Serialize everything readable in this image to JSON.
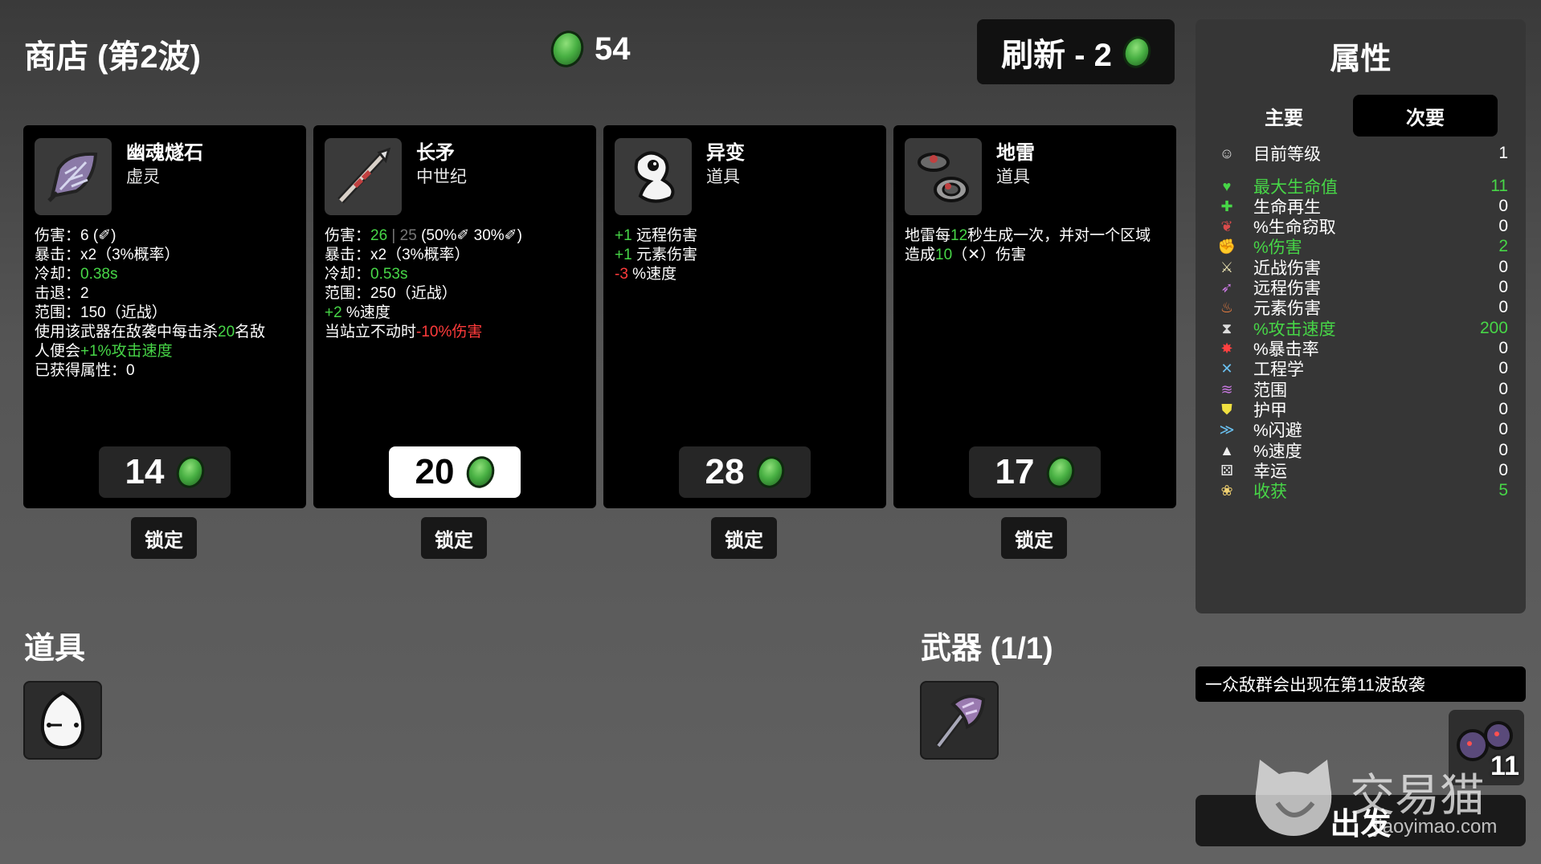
{
  "header": {
    "title": "商店 (第2波)",
    "gold": "54",
    "refresh_label": "刷新 - 2"
  },
  "shop": {
    "cards": [
      {
        "name": "幽魂燧石",
        "subtitle": "虚灵",
        "price": "14",
        "lock_label": "锁定",
        "icon": "flint-leaf-icon",
        "lines": [
          [
            {
              "t": "伤害：6 (",
              "c": ""
            },
            {
              "t": "✐",
              "c": ""
            },
            {
              "t": ")",
              "c": ""
            }
          ],
          [
            {
              "t": "暴击：x2（3%概率）",
              "c": ""
            }
          ],
          [
            {
              "t": "冷却：",
              "c": ""
            },
            {
              "t": "0.38s",
              "c": "g"
            }
          ],
          [
            {
              "t": "击退：2",
              "c": ""
            }
          ],
          [
            {
              "t": "范围：150（近战）",
              "c": ""
            }
          ],
          [
            {
              "t": "使用该武器在敌袭中每击杀",
              "c": ""
            },
            {
              "t": "20",
              "c": "g"
            },
            {
              "t": "名敌",
              "c": ""
            }
          ],
          [
            {
              "t": "人便会",
              "c": ""
            },
            {
              "t": "+1%攻击速度",
              "c": "g"
            }
          ],
          [
            {
              "t": "已获得属性：0",
              "c": ""
            }
          ]
        ]
      },
      {
        "name": "长矛",
        "subtitle": "中世纪",
        "price": "20",
        "lock_label": "锁定",
        "icon": "spear-icon",
        "selected": true,
        "lines": [
          [
            {
              "t": "伤害：",
              "c": ""
            },
            {
              "t": "26",
              "c": "g"
            },
            {
              "t": " | 25",
              "c": "gr"
            },
            {
              "t": " (50%✐ 30%✐)",
              "c": ""
            }
          ],
          [
            {
              "t": "暴击：x2（3%概率）",
              "c": ""
            }
          ],
          [
            {
              "t": "冷却：",
              "c": ""
            },
            {
              "t": "0.53s",
              "c": "g"
            }
          ],
          [
            {
              "t": "范围：250（近战）",
              "c": ""
            }
          ],
          [
            {
              "t": "+2",
              "c": "g"
            },
            {
              "t": " %速度",
              "c": ""
            }
          ],
          [
            {
              "t": "当站立不动时",
              "c": ""
            },
            {
              "t": "-10%伤害",
              "c": "r"
            }
          ]
        ]
      },
      {
        "name": "异变",
        "subtitle": "道具",
        "price": "28",
        "lock_label": "锁定",
        "icon": "ghost-blob-icon",
        "lines": [
          [
            {
              "t": "+1",
              "c": "g"
            },
            {
              "t": " 远程伤害",
              "c": ""
            }
          ],
          [
            {
              "t": "+1",
              "c": "g"
            },
            {
              "t": " 元素伤害",
              "c": ""
            }
          ],
          [
            {
              "t": "-3",
              "c": "r"
            },
            {
              "t": " %速度",
              "c": ""
            }
          ]
        ]
      },
      {
        "name": "地雷",
        "subtitle": "道具",
        "price": "17",
        "lock_label": "锁定",
        "icon": "landmine-icon",
        "lines": [
          [
            {
              "t": "地雷每",
              "c": ""
            },
            {
              "t": "12",
              "c": "g"
            },
            {
              "t": "秒生成一次，并对一个区域",
              "c": ""
            }
          ],
          [
            {
              "t": "造成",
              "c": ""
            },
            {
              "t": "10",
              "c": "g"
            },
            {
              "t": "（✕）伤害",
              "c": ""
            }
          ]
        ]
      }
    ]
  },
  "items_section": {
    "title": "道具",
    "items": [
      "egg-icon"
    ]
  },
  "weapons_section": {
    "title": "武器 (1/1)",
    "items": [
      "axe-icon"
    ]
  },
  "stats_panel": {
    "title": "属性",
    "tabs": [
      {
        "label": "主要",
        "active": false
      },
      {
        "label": "次要",
        "active": true
      }
    ],
    "rows": [
      {
        "label": "目前等级",
        "value": "1",
        "icon": "level-icon",
        "ic": "#ddd",
        "glyph": "☺",
        "highlight": false
      },
      {
        "label": "最大生命值",
        "value": "11",
        "icon": "heart-icon",
        "ic": "#47d647",
        "glyph": "♥",
        "highlight": true
      },
      {
        "label": "生命再生",
        "value": "0",
        "icon": "regen-icon",
        "ic": "#47d647",
        "glyph": "✚",
        "highlight": false
      },
      {
        "label": "%生命窃取",
        "value": "0",
        "icon": "lifesteal-icon",
        "ic": "#d94b4b",
        "glyph": "❦",
        "highlight": false
      },
      {
        "label": "%伤害",
        "value": "2",
        "icon": "damage-icon",
        "ic": "#e86a6a",
        "glyph": "✊",
        "highlight": true
      },
      {
        "label": "近战伤害",
        "value": "0",
        "icon": "melee-icon",
        "ic": "#e8e0b0",
        "glyph": "⚔",
        "highlight": false
      },
      {
        "label": "远程伤害",
        "value": "0",
        "icon": "ranged-icon",
        "ic": "#c878e0",
        "glyph": "➶",
        "highlight": false
      },
      {
        "label": "元素伤害",
        "value": "0",
        "icon": "elemental-icon",
        "ic": "#f08040",
        "glyph": "♨",
        "highlight": false
      },
      {
        "label": "%攻击速度",
        "value": "200",
        "icon": "attack-speed-icon",
        "ic": "#ddd",
        "glyph": "⧗",
        "highlight": true
      },
      {
        "label": "%暴击率",
        "value": "0",
        "icon": "crit-icon",
        "ic": "#ff4040",
        "glyph": "✸",
        "highlight": false
      },
      {
        "label": "工程学",
        "value": "0",
        "icon": "engineering-icon",
        "ic": "#6ac0f0",
        "glyph": "✕",
        "highlight": false
      },
      {
        "label": "范围",
        "value": "0",
        "icon": "range-icon",
        "ic": "#c878e0",
        "glyph": "≋",
        "highlight": false
      },
      {
        "label": "护甲",
        "value": "0",
        "icon": "armor-icon",
        "ic": "#f0e040",
        "glyph": "⛊",
        "highlight": false
      },
      {
        "label": "%闪避",
        "value": "0",
        "icon": "dodge-icon",
        "ic": "#6ac0f0",
        "glyph": "≫",
        "highlight": false
      },
      {
        "label": "%速度",
        "value": "0",
        "icon": "speed-icon",
        "ic": "#eee",
        "glyph": "▲",
        "highlight": false
      },
      {
        "label": "幸运",
        "value": "0",
        "icon": "luck-icon",
        "ic": "#eee",
        "glyph": "⚄",
        "highlight": false
      },
      {
        "label": "收获",
        "value": "5",
        "icon": "harvest-icon",
        "ic": "#f0d070",
        "glyph": "❀",
        "highlight": true
      }
    ]
  },
  "wave_notice": "一众敌群会出现在第11波敌袭",
  "enemy_wave_number": "11",
  "go_button_label": "出发",
  "watermark": {
    "text": "交易猫",
    "url": "jiaoyimao.com"
  },
  "colors": {
    "highlight_green": "#47d647",
    "negative_red": "#ff3b3b",
    "card_bg": "#000000",
    "panel_bg": "#363636"
  }
}
